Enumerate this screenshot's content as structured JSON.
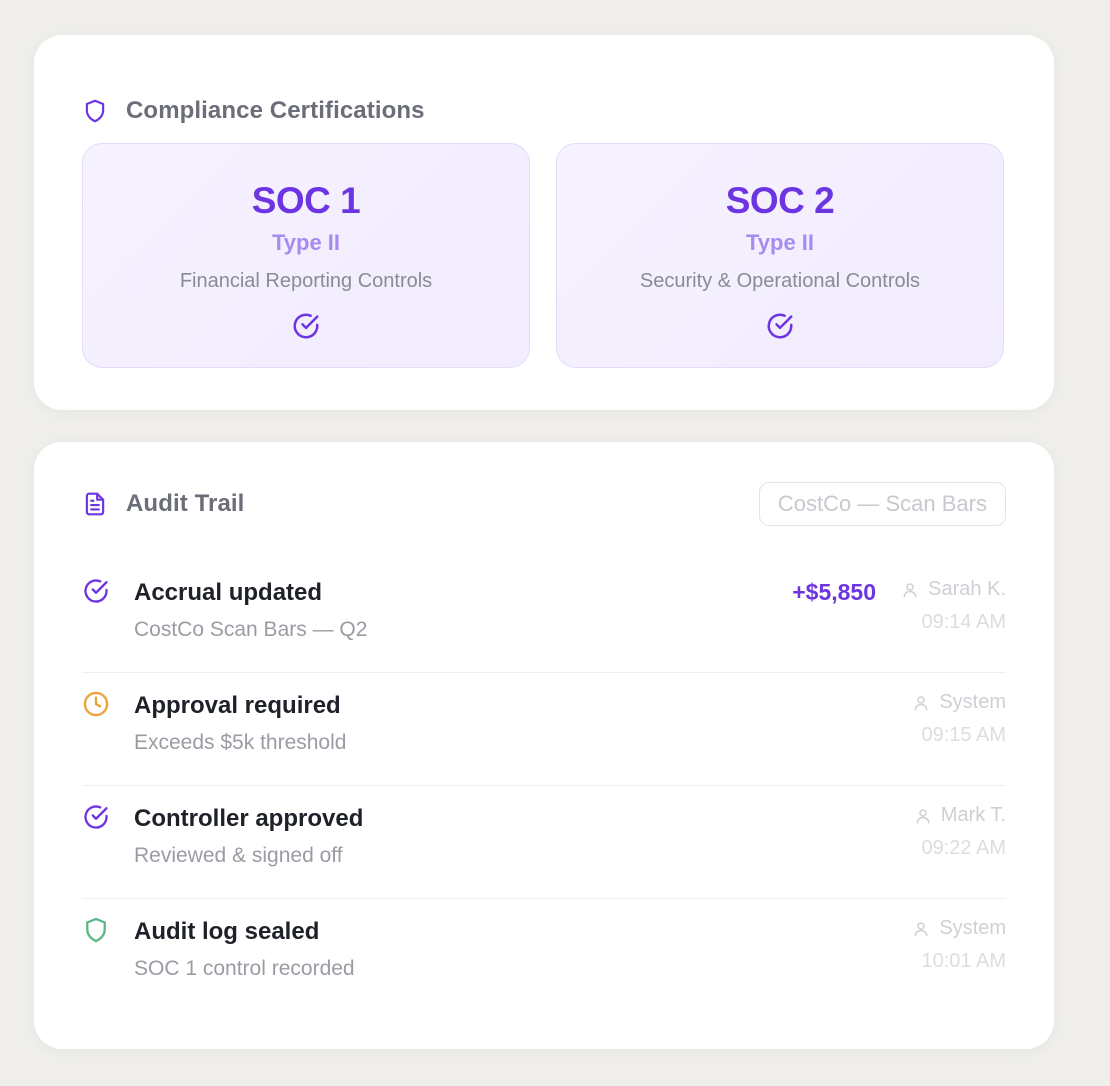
{
  "colors": {
    "accent": "#6d35e2",
    "accent_light": "#a78bf0",
    "pending": "#e8a33d",
    "success": "#5cb88a"
  },
  "certifications": {
    "title": "Compliance Certifications",
    "icon": "shield-icon",
    "items": [
      {
        "name": "SOC 1",
        "type": "Type II",
        "description": "Financial Reporting Controls",
        "icon": "check-circle-icon"
      },
      {
        "name": "SOC 2",
        "type": "Type II",
        "description": "Security & Operational Controls",
        "icon": "check-circle-icon"
      }
    ]
  },
  "audit": {
    "title": "Audit Trail",
    "icon": "document-icon",
    "filter": "CostCo — Scan Bars",
    "events": [
      {
        "title": "Accrual updated",
        "subtitle": "CostCo Scan Bars — Q2",
        "amount": "+$5,850",
        "user": "Sarah K.",
        "time": "09:14 AM",
        "icon": "check-circle-icon",
        "status": "complete"
      },
      {
        "title": "Approval required",
        "subtitle": "Exceeds $5k threshold",
        "user": "System",
        "time": "09:15 AM",
        "icon": "clock-icon",
        "status": "pending"
      },
      {
        "title": "Controller approved",
        "subtitle": "Reviewed & signed off",
        "user": "Mark T.",
        "time": "09:22 AM",
        "icon": "check-circle-icon",
        "status": "complete"
      },
      {
        "title": "Audit log sealed",
        "subtitle": "SOC 1 control recorded",
        "user": "System",
        "time": "10:01 AM",
        "icon": "shield-icon",
        "status": "sealed"
      }
    ]
  }
}
